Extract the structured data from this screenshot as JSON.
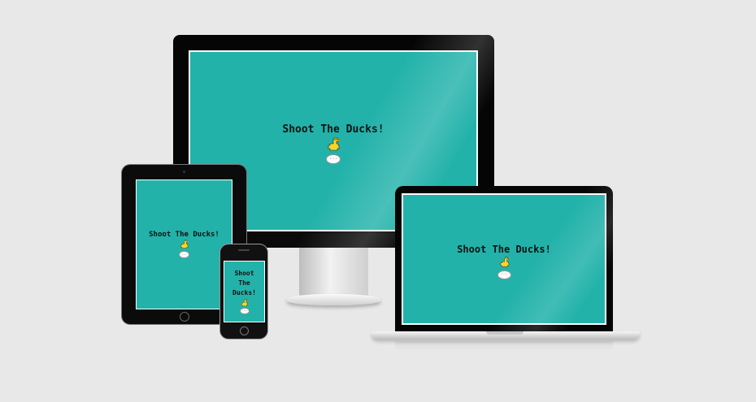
{
  "game": {
    "title": "Shoot The Ducks!",
    "start_button_label": "···"
  },
  "devices": {
    "monitor": {
      "title_lines": [
        "Shoot The Ducks!"
      ]
    },
    "tablet": {
      "title_lines": [
        "Shoot The Ducks!"
      ]
    },
    "laptop": {
      "title_lines": [
        "Shoot The Ducks!"
      ]
    },
    "phone": {
      "title_lines": [
        "Shoot",
        "The",
        "Ducks!"
      ]
    }
  },
  "colors": {
    "screen_background": "#22b2aa",
    "page_background": "#e8e8e8",
    "duck_body": "#f5d728",
    "duck_beak": "#f08a1c",
    "bezel": "#050505"
  },
  "icons": {
    "duck": "duck-icon",
    "start": "ellipsis-button"
  }
}
